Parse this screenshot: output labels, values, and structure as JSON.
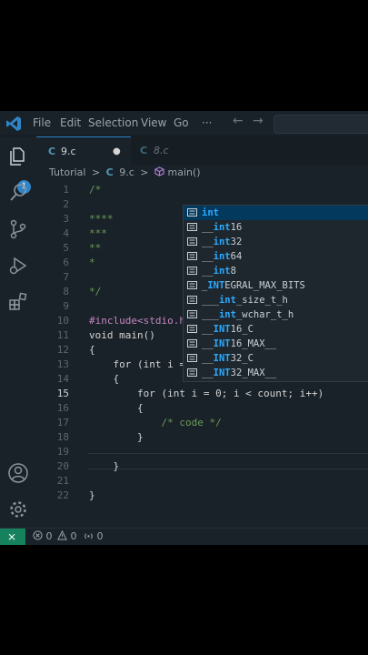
{
  "menu": [
    "File",
    "Edit",
    "Selection",
    "View",
    "Go",
    "···"
  ],
  "nav": {
    "back": "←",
    "forward": "→"
  },
  "activity": {
    "badge": "1"
  },
  "tabs": [
    {
      "icon": "C",
      "label": "9.c",
      "active": true,
      "dirty": "●"
    },
    {
      "icon": "C",
      "label": "8.c",
      "active": false
    }
  ],
  "breadcrumb": {
    "folder": "Tutorial",
    "sep": ">",
    "file_icon": "C",
    "file": "9.c",
    "symbol": "main()"
  },
  "editor": {
    "current_line": 15,
    "lines": [
      {
        "n": "1",
        "text": "/*"
      },
      {
        "n": "2",
        "text": ""
      },
      {
        "n": "3",
        "text": "****"
      },
      {
        "n": "4",
        "text": "***"
      },
      {
        "n": "5",
        "text": "**"
      },
      {
        "n": "6",
        "text": "*"
      },
      {
        "n": "7",
        "text": ""
      },
      {
        "n": "8",
        "text": "*/"
      },
      {
        "n": "9",
        "text": ""
      },
      {
        "n": "10",
        "text": "#include<stdio.h"
      },
      {
        "n": "11",
        "text": "void main()"
      },
      {
        "n": "12",
        "text": "{"
      },
      {
        "n": "13",
        "text": "    for (int i ="
      },
      {
        "n": "14",
        "text": "    {"
      },
      {
        "n": "15",
        "text": "        for (int i = 0; i < count; i++)"
      },
      {
        "n": "16",
        "text": "        {"
      },
      {
        "n": "17",
        "text": "            /* code */"
      },
      {
        "n": "18",
        "text": "        }"
      },
      {
        "n": "19",
        "text": ""
      },
      {
        "n": "20",
        "text": "    }"
      },
      {
        "n": "21",
        "text": ""
      },
      {
        "n": "22",
        "text": "}"
      }
    ]
  },
  "suggestions": [
    {
      "pre": "",
      "match": "int",
      "post": "",
      "selected": true
    },
    {
      "pre": "__",
      "match": "int",
      "post": "16"
    },
    {
      "pre": "__",
      "match": "int",
      "post": "32"
    },
    {
      "pre": "__",
      "match": "int",
      "post": "64"
    },
    {
      "pre": "__",
      "match": "int",
      "post": "8"
    },
    {
      "pre": "_",
      "match": "INT",
      "post": "EGRAL_MAX_BITS"
    },
    {
      "pre": "___",
      "match": "int",
      "post": "_size_t_h"
    },
    {
      "pre": "___",
      "match": "int",
      "post": "_wchar_t_h"
    },
    {
      "pre": "__",
      "match": "INT",
      "post": "16_C"
    },
    {
      "pre": "__",
      "match": "INT",
      "post": "16_MAX__"
    },
    {
      "pre": "__",
      "match": "INT",
      "post": "32_C"
    },
    {
      "pre": "__",
      "match": "INT",
      "post": "32_MAX__"
    }
  ],
  "status": {
    "remote": "⨯",
    "errors": "0",
    "warnings": "0",
    "ports": "0"
  },
  "colors": {
    "accent": "#2f85c7",
    "keyword": "#c586c0",
    "type": "#569cd6",
    "comment": "#6a9955",
    "variable": "#9cdcfe",
    "match": "#2aaaff",
    "remote": "#16825d"
  }
}
